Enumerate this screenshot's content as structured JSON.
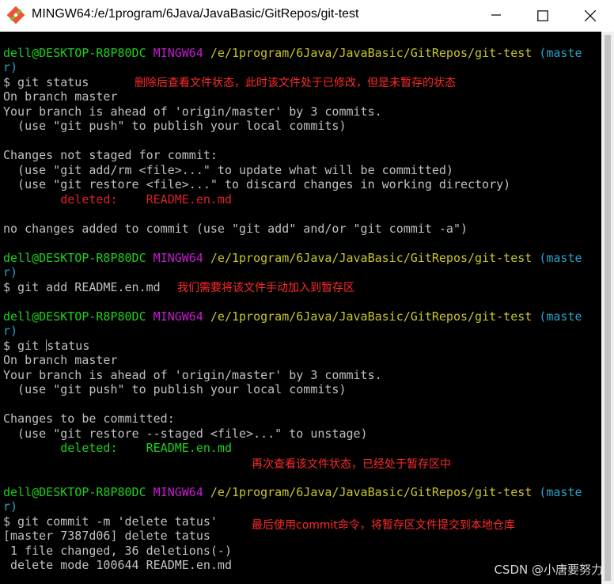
{
  "window": {
    "title": "MINGW64:/e/1program/6Java/JavaBasic/GitRepos/git-test",
    "icon": "git-bash-icon"
  },
  "prompt": {
    "user_host": "dell@DESKTOP-R8P80DC",
    "shell": "MINGW64",
    "path": "/e/1program/6Java/JavaBasic/GitRepos/git-test",
    "branch_open": "(maste",
    "branch_close": "r)"
  },
  "terminal": {
    "cmd1": "$ git status",
    "out1": [
      "On branch master",
      "Your branch is ahead of 'origin/master' by 3 commits.",
      "  (use \"git push\" to publish your local commits)",
      "",
      "Changes not staged for commit:",
      "  (use \"git add/rm <file>...\" to update what will be committed)",
      "  (use \"git restore <file>...\" to discard changes in working directory)"
    ],
    "deleted1_label": "        deleted:    README.en.md",
    "out1_tail": "no changes added to commit (use \"git add\" and/or \"git commit -a\")",
    "cmd2": "$ git add README.en.md",
    "cmd3_pre": "$ git ",
    "cmd3_post": "status",
    "out3": [
      "On branch master",
      "Your branch is ahead of 'origin/master' by 3 commits.",
      "  (use \"git push\" to publish your local commits)",
      "",
      "Changes to be committed:",
      "  (use \"git restore --staged <file>...\" to unstage)"
    ],
    "deleted3_label": "        deleted:    README.en.md",
    "cmd4": "$ git commit -m 'delete tatus'",
    "out4": [
      "[master 7387d06] delete tatus",
      " 1 file changed, 36 deletions(-)",
      " delete mode 100644 README.en.md"
    ]
  },
  "annotations": {
    "note1": "删除后查看文件状态，此时该文件处于已修改，但是未暂存的状态",
    "note2": "我们需要将该文件手动加入到暂存区",
    "note3": "再次查看该文件状态，已经处于暂存区中",
    "note4": "最后使用commit命令，将暂存区文件提交到本地仓库"
  },
  "watermark": "CSDN @小唐要努力",
  "colors": {
    "background": "#000000",
    "text": "#c0c0c0",
    "user_host": "#1cd219",
    "shell": "#c51bd0",
    "path": "#c9c62a",
    "branch": "#2aa2c8",
    "deleted_unstaged": "#d8232a",
    "deleted_staged": "#1cd219",
    "annotation": "#ff2a2a"
  }
}
